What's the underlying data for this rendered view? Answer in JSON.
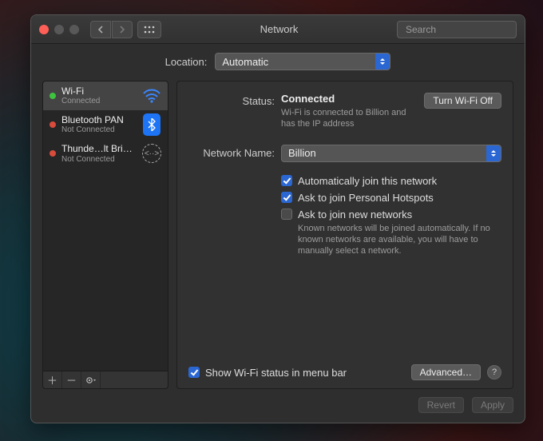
{
  "window": {
    "title": "Network"
  },
  "search": {
    "placeholder": "Search"
  },
  "location": {
    "label": "Location:",
    "value": "Automatic"
  },
  "sidebar": {
    "items": [
      {
        "name": "Wi-Fi",
        "sub": "Connected",
        "status": "green",
        "icon": "wifi-icon",
        "selected": true
      },
      {
        "name": "Bluetooth PAN",
        "sub": "Not Connected",
        "status": "red",
        "icon": "bluetooth-icon",
        "selected": false
      },
      {
        "name": "Thunde…lt Bridge",
        "sub": "Not Connected",
        "status": "red",
        "icon": "thunderbolt-icon",
        "selected": false
      }
    ]
  },
  "detail": {
    "status_label": "Status:",
    "status_value": "Connected",
    "status_desc": "Wi-Fi is connected to Billion and has the IP address",
    "wifitoggle": "Turn Wi-Fi Off",
    "netname_label": "Network Name:",
    "netname_value": "Billion",
    "opts": {
      "autojoin": "Automatically join this network",
      "hotspots": "Ask to join Personal Hotspots",
      "asknew": "Ask to join new networks",
      "asknew_desc": "Known networks will be joined automatically. If no known networks are available, you will have to manually select a network."
    },
    "showmenu": "Show Wi-Fi status in menu bar",
    "advanced": "Advanced…"
  },
  "buttons": {
    "revert": "Revert",
    "apply": "Apply"
  }
}
